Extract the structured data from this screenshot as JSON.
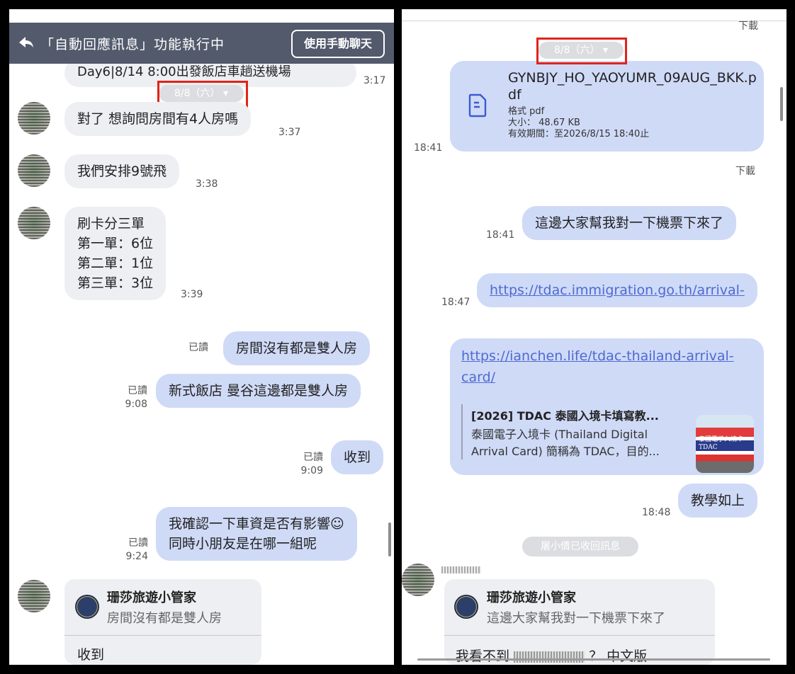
{
  "left": {
    "header": {
      "title": "「自動回應訊息」功能執行中",
      "manual_chat_button": "使用手動聊天"
    },
    "prev_message": {
      "text": "Day6|8/14 8:00出發飯店車趟送機場",
      "time": "3:17"
    },
    "date_pill": "8/8（六）",
    "incoming": [
      {
        "text": "對了 想詢問房間有4人房嗎",
        "time": "3:37"
      },
      {
        "text": "我們安排9號飛",
        "time": "3:38"
      },
      {
        "lines": [
          "刷卡分三單",
          "第一單：6位",
          "第二單：1位",
          "第三單：3位"
        ],
        "time": "3:39"
      }
    ],
    "outgoing": [
      {
        "text": "房間沒有都是雙人房",
        "status": "已讀",
        "time": ""
      },
      {
        "text": "新式飯店 曼谷這邊都是雙人房",
        "status": "已讀",
        "time": "9:08"
      },
      {
        "text": "收到",
        "status": "已讀",
        "time": "9:09"
      },
      {
        "lines": [
          "我確認一下車資是否有影響☺",
          "同時小朋友是在哪一組呢"
        ],
        "status": "已讀",
        "time": "9:24"
      }
    ],
    "reply": {
      "name": "珊莎旅遊小管家",
      "quote": "房間沒有都是雙人房",
      "body": "收到"
    }
  },
  "right": {
    "top_download": "下載",
    "date_pill": "8/8（六）",
    "file": {
      "name_line1": "GYNBJY_HO_YAOYUMR_09AUG_BKK.p",
      "name_line2": "df",
      "format": "格式 pdf",
      "size": "大小： 48.67 KB",
      "expiry": "有效期間：至2026/8/15 18:40止",
      "time": "18:41",
      "download": "下載"
    },
    "messages": [
      {
        "text": "這邊大家幫我對一下機票下來了",
        "time": "18:41"
      },
      {
        "text": "https://tdac.immigration.go.th/arrival-",
        "time": "18:47"
      }
    ],
    "link_preview": {
      "url_line1": "https://ianchen.life/tdac-thailand-arrival-",
      "url_line2": "card/",
      "title": "[2026] TDAC 泰國入境卡填寫教...",
      "desc_line1": "泰國電子入境卡 (Thailand Digital",
      "desc_line2": "Arrival Card) 簡稱為 TDAC，目的...",
      "thumb_caption": "泰國電子入境卡 TDAC"
    },
    "teach": {
      "text": "教學如上",
      "time": "18:48"
    },
    "recall_notice": "屠小倩已收回訊息",
    "reply": {
      "name": "珊莎旅遊小管家",
      "quote": "這邊大家幫我對一下機票下來了",
      "body": "我看不到",
      "body_suffix": "？ 中文版"
    }
  }
}
